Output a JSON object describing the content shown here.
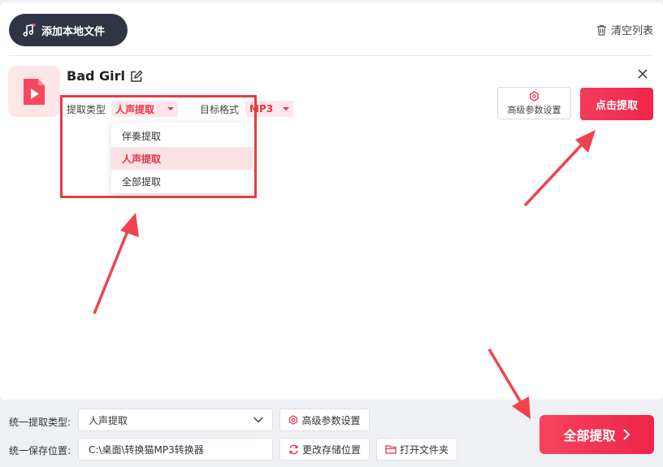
{
  "toolbar": {
    "add_label": "添加本地文件",
    "clear_label": "清空列表"
  },
  "file": {
    "name": "Bad Girl",
    "type_label": "提取类型",
    "type_value": "人声提取",
    "format_label": "目标格式",
    "format_value": "MP3",
    "dropdown_options": [
      "伴奏提取",
      "人声提取",
      "全部提取"
    ],
    "selected_option": "人声提取",
    "advanced_label": "高级参数设置",
    "extract_label": "点击提取"
  },
  "footer": {
    "type_label": "统一提取类型:",
    "type_value": "人声提取",
    "advanced_label": "高级参数设置",
    "path_label": "统一保存位置:",
    "path_value": "C:\\桌面\\转换猫MP3转换器",
    "change_path_label": "更改存储位置",
    "open_folder_label": "打开文件夹",
    "extract_all_label": "全部提取"
  },
  "colors": {
    "accent": "#f0264a",
    "dark_button": "#2f3545",
    "annotation": "#e53b46"
  },
  "icons": {
    "add": "music-note-plus-icon",
    "clear": "trash-icon",
    "thumb": "video-play-icon",
    "edit": "edit-icon",
    "close": "close-icon",
    "settings": "hexagon-gear-icon",
    "dropdown": "chevron-down-icon",
    "change_path": "refresh-icon",
    "folder": "folder-icon",
    "chevron_right": "chevron-right-icon"
  }
}
